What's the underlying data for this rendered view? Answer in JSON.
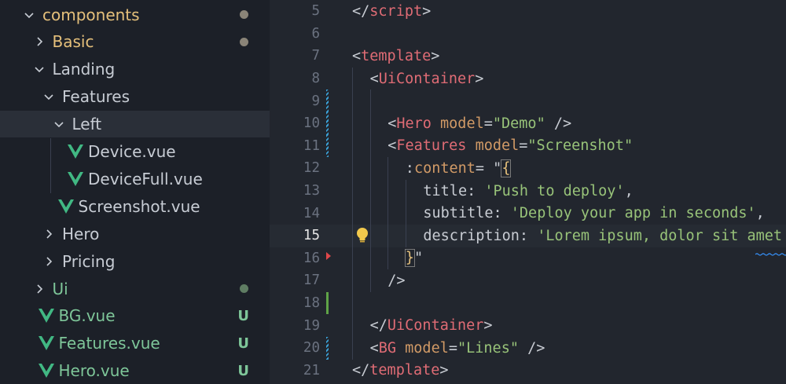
{
  "colors": {
    "folder": "#e5c07b",
    "vue_green": "#7ec699",
    "added": "#7ec699",
    "modified_dot": "#8a8478",
    "untracked_dot": "#5f7d63"
  },
  "explorer": {
    "items": [
      {
        "label": "components",
        "chevron": "down",
        "indent": 0,
        "color": "#e5c07b",
        "status": "dot-modified"
      },
      {
        "label": "Basic",
        "chevron": "right",
        "indent": 1,
        "color": "#e5c07b",
        "status": "dot-modified"
      },
      {
        "label": "Landing",
        "chevron": "down",
        "indent": 1,
        "color": "#c7ccd4",
        "status": ""
      },
      {
        "label": "Features",
        "chevron": "down",
        "indent": 2,
        "color": "#c7ccd4",
        "status": ""
      },
      {
        "label": "Left",
        "chevron": "down",
        "indent": 3,
        "color": "#c7ccd4",
        "status": "",
        "selected": true
      },
      {
        "label": "Device.vue",
        "file": true,
        "indent": 4,
        "color": "#c7ccd4",
        "status": ""
      },
      {
        "label": "DeviceFull.vue",
        "file": true,
        "indent": 4,
        "color": "#c7ccd4",
        "status": ""
      },
      {
        "label": "Screenshot.vue",
        "file": true,
        "indent": 3,
        "color": "#c7ccd4",
        "status": ""
      },
      {
        "label": "Hero",
        "chevron": "right",
        "indent": 2,
        "color": "#c7ccd4",
        "status": ""
      },
      {
        "label": "Pricing",
        "chevron": "right",
        "indent": 2,
        "color": "#c7ccd4",
        "status": ""
      },
      {
        "label": "Ui",
        "chevron": "right",
        "indent": 1,
        "color": "#7ec699",
        "status": "dot-untracked"
      },
      {
        "label": "BG.vue",
        "file": true,
        "indent": 1,
        "color": "#7ec699",
        "status": "U"
      },
      {
        "label": "Features.vue",
        "file": true,
        "indent": 1,
        "color": "#7ec699",
        "status": "U"
      },
      {
        "label": "Hero.vue",
        "file": true,
        "indent": 1,
        "color": "#7ec699",
        "status": "U"
      }
    ]
  },
  "editor": {
    "active_line": 15,
    "lines": [
      {
        "n": "5",
        "indent": 0,
        "tokens": [
          [
            "pun",
            "</"
          ],
          [
            "tag",
            "script"
          ],
          [
            "pun",
            ">"
          ]
        ]
      },
      {
        "n": "6",
        "indent": 0,
        "tokens": []
      },
      {
        "n": "7",
        "indent": 0,
        "tokens": [
          [
            "pun",
            "<"
          ],
          [
            "tag",
            "template"
          ],
          [
            "pun",
            ">"
          ]
        ]
      },
      {
        "n": "8",
        "indent": 1,
        "tokens": [
          [
            "pun",
            "<"
          ],
          [
            "tag",
            "UiContainer"
          ],
          [
            "pun",
            ">"
          ]
        ]
      },
      {
        "n": "9",
        "indent": 0,
        "tokens": [],
        "mark": "hatch"
      },
      {
        "n": "10",
        "indent": 2,
        "tokens": [
          [
            "pun",
            "<"
          ],
          [
            "tag",
            "Hero"
          ],
          [
            "pun",
            " "
          ],
          [
            "attr",
            "model"
          ],
          [
            "pun",
            "="
          ],
          [
            "str",
            "\"Demo\""
          ],
          [
            "pun",
            " />"
          ]
        ],
        "mark": "hatch"
      },
      {
        "n": "11",
        "indent": 2,
        "tokens": [
          [
            "pun",
            "<"
          ],
          [
            "tag",
            "Features"
          ],
          [
            "pun",
            " "
          ],
          [
            "attr",
            "model"
          ],
          [
            "pun",
            "="
          ],
          [
            "str",
            "\"Screenshot\""
          ]
        ],
        "mark": "hatch"
      },
      {
        "n": "12",
        "indent": 3,
        "tokens": [
          [
            "pun",
            ":"
          ],
          [
            "attr",
            "content"
          ],
          [
            "pun",
            "= \""
          ],
          [
            "brk",
            "{"
          ]
        ]
      },
      {
        "n": "13",
        "indent": 4,
        "tokens": [
          [
            "pun",
            "title: "
          ],
          [
            "str",
            "'Push to deploy'"
          ],
          [
            "pun",
            ","
          ]
        ]
      },
      {
        "n": "14",
        "indent": 4,
        "tokens": [
          [
            "pun",
            "subtitle: "
          ],
          [
            "str",
            "'Deploy your app in seconds'"
          ],
          [
            "pun",
            ","
          ]
        ]
      },
      {
        "n": "15",
        "indent": 4,
        "tokens": [
          [
            "pun",
            "description: "
          ],
          [
            "str",
            "'Lorem ipsum, dolor sit amet"
          ]
        ],
        "bulb": true
      },
      {
        "n": "16",
        "indent": 3,
        "tokens": [
          [
            "brk",
            "}"
          ],
          [
            "pun",
            "\""
          ]
        ],
        "mark": "deleted"
      },
      {
        "n": "17",
        "indent": 2,
        "tokens": [
          [
            "pun",
            "/>"
          ]
        ]
      },
      {
        "n": "18",
        "indent": 0,
        "tokens": [],
        "mark": "added"
      },
      {
        "n": "19",
        "indent": 1,
        "tokens": [
          [
            "pun",
            "</"
          ],
          [
            "tag",
            "UiContainer"
          ],
          [
            "pun",
            ">"
          ]
        ]
      },
      {
        "n": "20",
        "indent": 1,
        "tokens": [
          [
            "pun",
            "<"
          ],
          [
            "tag",
            "BG"
          ],
          [
            "pun",
            " "
          ],
          [
            "attr",
            "model"
          ],
          [
            "pun",
            "="
          ],
          [
            "str",
            "\"Lines\""
          ],
          [
            "pun",
            " />"
          ]
        ],
        "mark": "hatch"
      },
      {
        "n": "21",
        "indent": 0,
        "tokens": [
          [
            "pun",
            "</"
          ],
          [
            "tag",
            "template"
          ],
          [
            "pun",
            ">"
          ]
        ]
      }
    ]
  }
}
